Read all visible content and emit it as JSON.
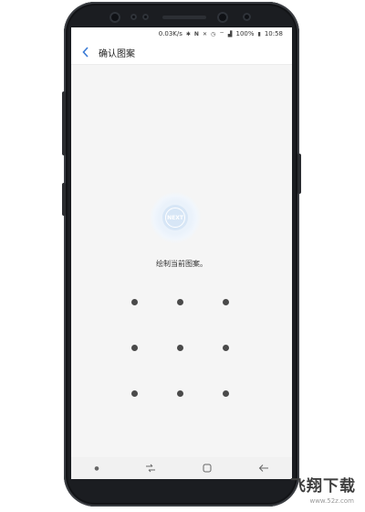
{
  "status_bar": {
    "speed": "0.03K/s",
    "icons": [
      "bluetooth-icon",
      "nfc-icon",
      "mute-icon",
      "alarm-icon",
      "wifi-icon",
      "signal-icon",
      "battery-icon"
    ],
    "battery": "100%",
    "time": "10:58"
  },
  "header": {
    "back_icon": "chevron-left-icon",
    "title": "确认图案"
  },
  "content": {
    "logo_text": "NEXT",
    "instruction": "绘制当前图案。"
  },
  "pattern_grid": {
    "rows": 3,
    "cols": 3
  },
  "nav_bar": {
    "items": [
      "dot-icon",
      "recents-icon",
      "home-icon",
      "back-arrow-icon"
    ]
  },
  "watermark": {
    "main": "飞翔下载",
    "url": "www.52z.com"
  },
  "colors": {
    "accent": "#3b7bd6",
    "dot": "#4a4a4a",
    "phone": "#1b1d21"
  }
}
